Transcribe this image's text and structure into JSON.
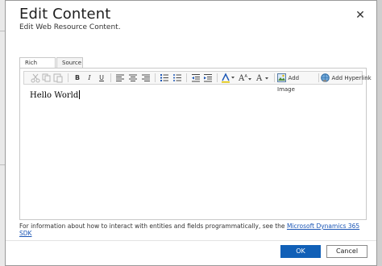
{
  "dialog": {
    "title": "Edit Content",
    "subtitle": "Edit Web Resource Content.",
    "close_icon": "close-icon"
  },
  "tabs": [
    {
      "label": "Rich Text",
      "active": true
    },
    {
      "label": "Source",
      "active": false
    }
  ],
  "toolbar": {
    "bold": "B",
    "italic": "I",
    "underline": "U",
    "font_size_glyph": "A",
    "font_glyph": "A",
    "add_image": "Add Image",
    "add_hyperlink": "Add Hyperlink"
  },
  "editor": {
    "content": "Hello World"
  },
  "info": {
    "text": "For information about how to interact with entities and fields programmatically, see the ",
    "link": "Microsoft Dynamics 365 SDK"
  },
  "buttons": {
    "ok": "OK",
    "cancel": "Cancel"
  },
  "colors": {
    "accent": "#1160b7",
    "link": "#1a55b5"
  }
}
